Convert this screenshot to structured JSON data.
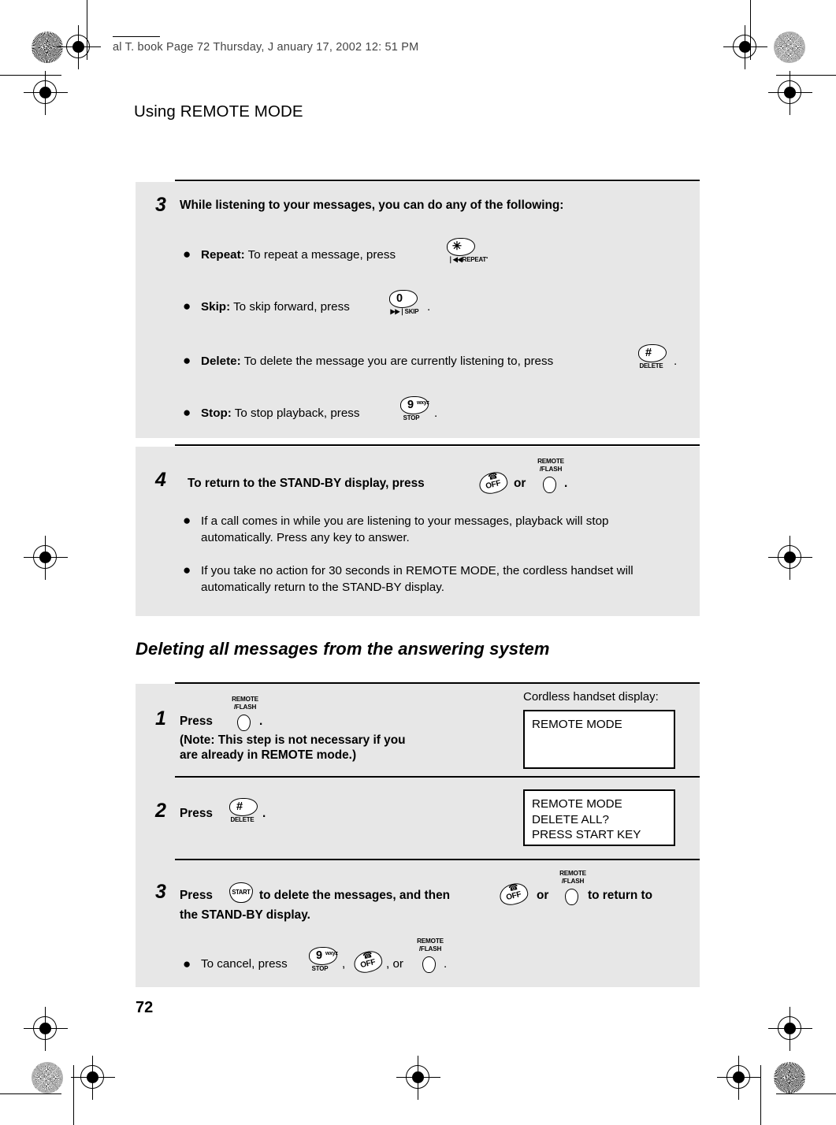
{
  "header": {
    "file_line": "al T. book  Page 72  Thursday, J anuary 17,  2002  12: 51 PM",
    "page_title": "Using REMOTE MODE",
    "page_number": "72"
  },
  "section_heading": "Deleting all messages from the answering system",
  "step3": {
    "number": "3",
    "heading": "While listening to your messages, you can do any of the following:",
    "items": [
      {
        "label": "Repeat:",
        "text": "To repeat a message, press",
        "tail": ".",
        "key": "star-repeat"
      },
      {
        "label": "Skip:",
        "text": "To skip forward, press",
        "tail": ".",
        "key": "zero-skip"
      },
      {
        "label": "Delete:",
        "text": "To delete the message you are currently listening to, press",
        "tail": ".",
        "key": "hash-delete"
      },
      {
        "label": "Stop:",
        "text": "To stop playback, press",
        "tail": ".",
        "key": "nine-stop"
      }
    ]
  },
  "step4": {
    "number": "4",
    "heading_pre": "To return to the STAND-BY display, press",
    "heading_or": "or",
    "heading_tail": ".",
    "notes": [
      "If a call comes in while you are listening to your messages, playback will stop automatically. Press any key to answer.",
      "If you take no action for 30 seconds in REMOTE MODE, the cordless handset will automatically return to the STAND-BY display."
    ]
  },
  "delete_all": {
    "lcd_caption": "Cordless handset display:",
    "step1": {
      "number": "1",
      "press_label": "Press",
      "tail": ".",
      "note_line1": "(Note: This step is not necessary if you",
      "note_line2": "are already in REMOTE mode.)",
      "lcd": [
        "REMOTE MODE"
      ]
    },
    "step2": {
      "number": "2",
      "press_label": "Press",
      "tail": ".",
      "lcd": [
        "REMOTE MODE",
        "DELETE ALL?",
        "PRESS START KEY"
      ]
    },
    "step3": {
      "number": "3",
      "text_a": "Press",
      "text_b": "to delete the messages, and then",
      "text_or": "or",
      "text_c": "to return to",
      "text_d": "the STAND-BY display.",
      "cancel_pre": "To cancel, press",
      "cancel_comma1": ",",
      "cancel_comma2": ", or",
      "cancel_tail": "."
    }
  },
  "keys": {
    "star_repeat": {
      "glyph": "✳",
      "caption": "❘◀◀REPEAT"
    },
    "zero_skip": {
      "glyph": "0",
      "caption": "▶▶❘SKIP"
    },
    "hash_delete": {
      "glyph": "#",
      "caption": "DELETE"
    },
    "nine_stop": {
      "glyph": "9",
      "sub": "wxyz",
      "caption": "STOP"
    },
    "off": {
      "label": "OFF",
      "icon": "☎"
    },
    "remote_flash": {
      "cap_line1": "REMOTE",
      "cap_line2": "/FLASH"
    },
    "start": {
      "label": "START"
    }
  },
  "colors": {
    "panel_gray": "#e7e7e7",
    "rule_black": "#000000",
    "page_white": "#ffffff"
  }
}
